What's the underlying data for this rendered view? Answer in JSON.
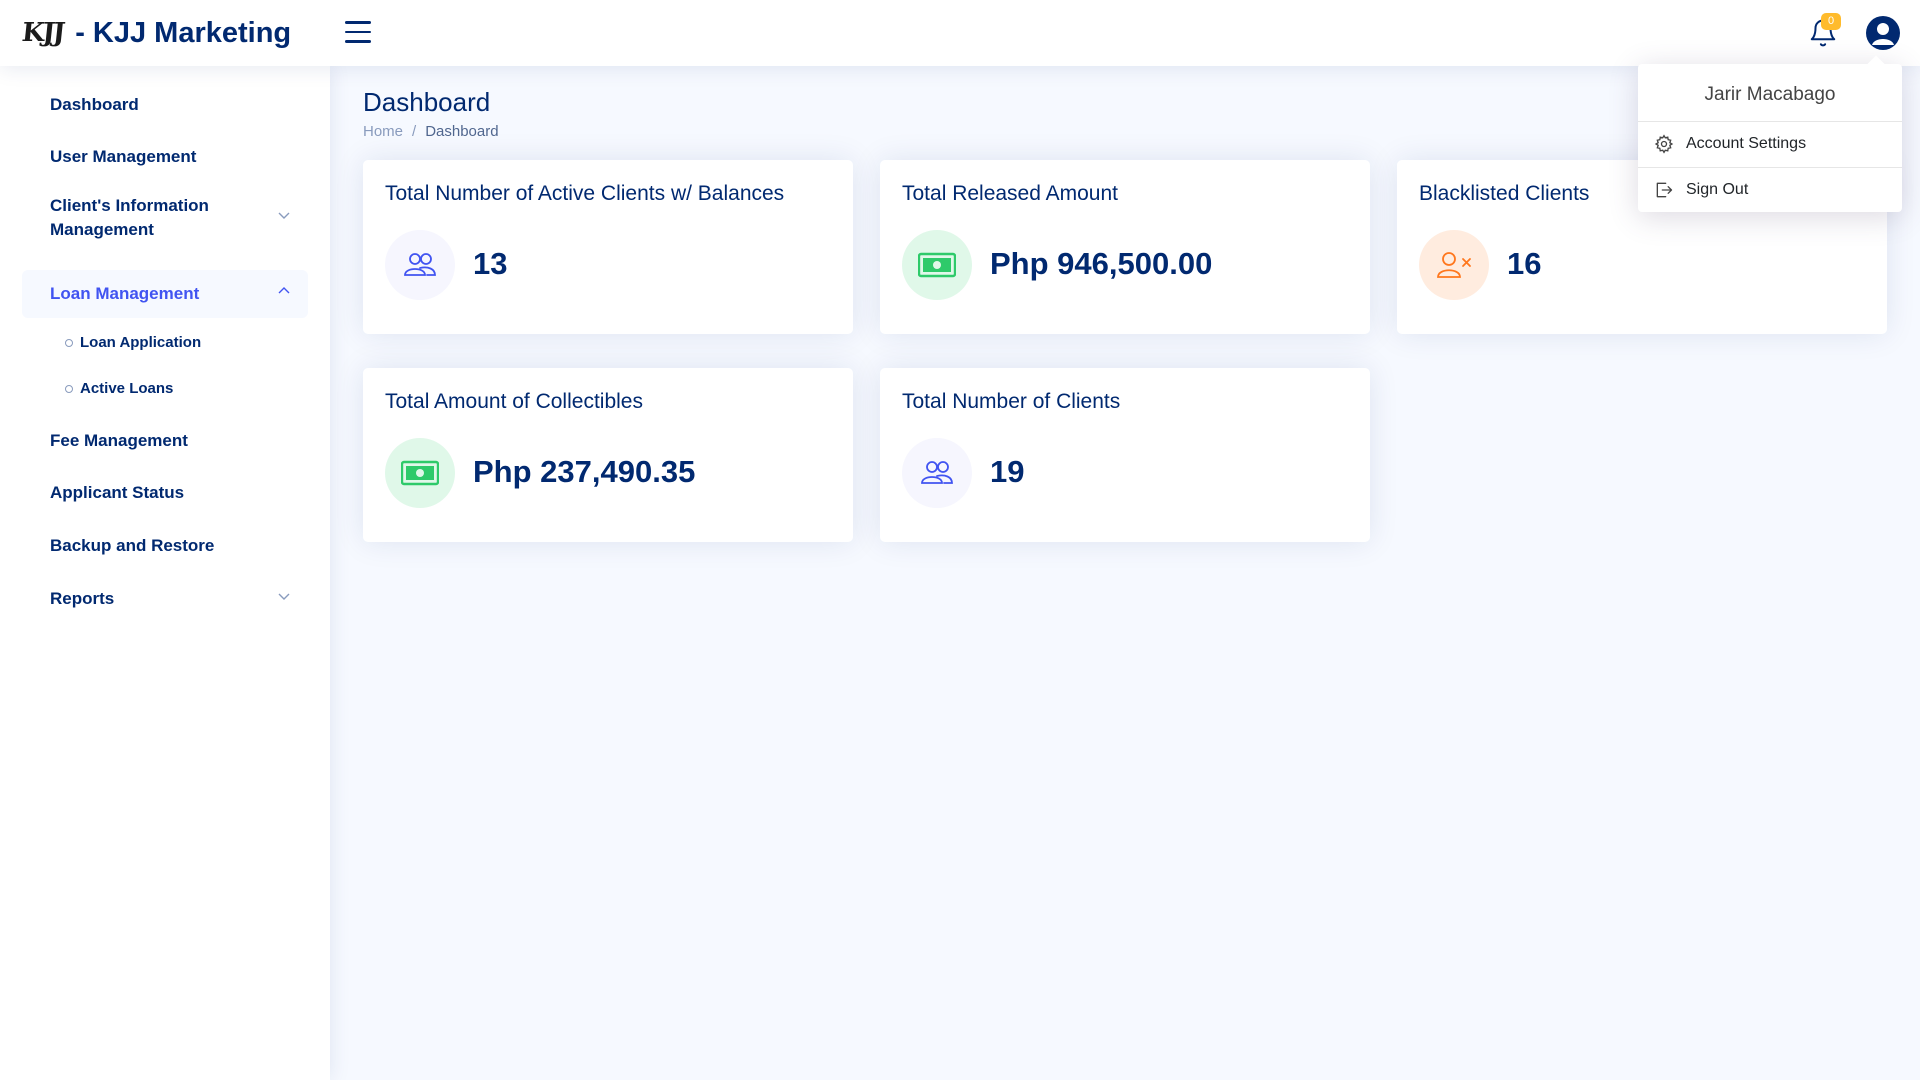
{
  "header": {
    "logo_mark": "KJJ",
    "brand_text": "- KJJ Marketing",
    "notification_count": "0"
  },
  "sidebar": {
    "items": [
      {
        "label": "Dashboard"
      },
      {
        "label": "User Management"
      },
      {
        "label": "Client's Information Management"
      },
      {
        "label": "Loan Management"
      },
      {
        "label": "Fee Management"
      },
      {
        "label": "Applicant Status"
      },
      {
        "label": "Backup and Restore"
      },
      {
        "label": "Reports"
      }
    ],
    "loan_subitems": [
      {
        "label": "Loan Application"
      },
      {
        "label": "Active Loans"
      }
    ]
  },
  "main": {
    "title": "Dashboard",
    "breadcrumb": {
      "home": "Home",
      "separator": "/",
      "current": "Dashboard"
    },
    "cards": [
      {
        "title": "Total Number of Active Clients w/ Balances",
        "value": "13",
        "icon": "people-icon",
        "color": "#4154f1"
      },
      {
        "title": "Total Released Amount",
        "value": "Php 946,500.00",
        "icon": "cash-icon",
        "color": "#2eca6a"
      },
      {
        "title": "Blacklisted Clients",
        "value": "16",
        "icon": "person-x-icon",
        "color": "#ff771d"
      },
      {
        "title": "Total Amount of Collectibles",
        "value": "Php 237,490.35",
        "icon": "cash-icon",
        "color": "#2eca6a"
      },
      {
        "title": "Total Number of Clients",
        "value": "19",
        "icon": "people-icon",
        "color": "#4154f1"
      }
    ]
  },
  "profile_dropdown": {
    "name": "Jarir Macabago",
    "account_settings": "Account Settings",
    "sign_out": "Sign Out"
  },
  "colors": {
    "primary": "#012970",
    "accent": "#4154f1",
    "badge": "#ffbb2c",
    "background": "#f6f9ff"
  }
}
